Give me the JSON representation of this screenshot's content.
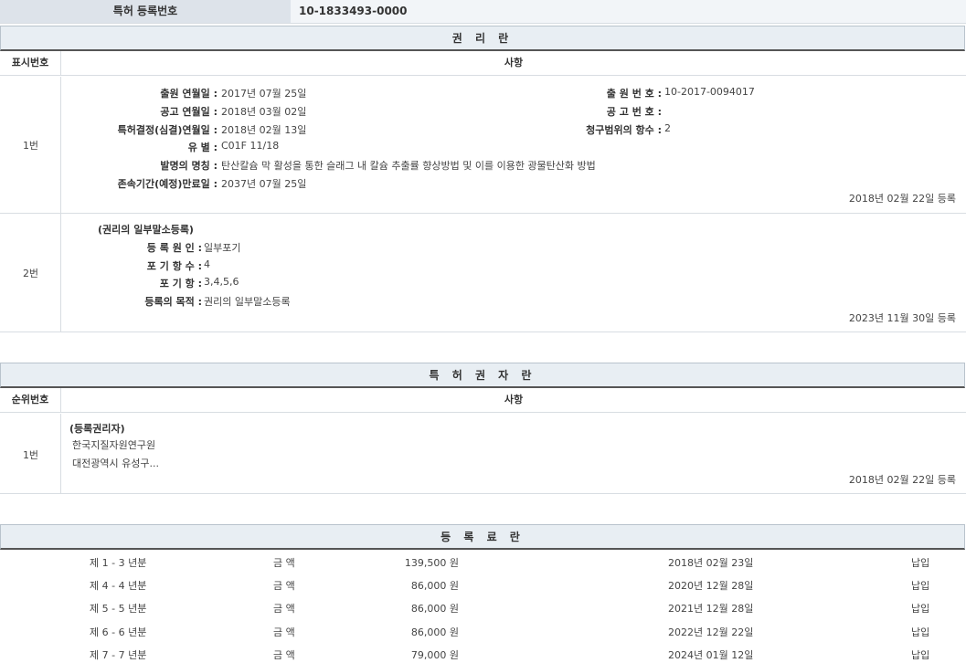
{
  "top": {
    "label": "특허 등록번호",
    "value": "10-1833493-0000"
  },
  "rights": {
    "title": "권 리 란",
    "col1": "표시번호",
    "col2": "사항",
    "row1": {
      "num": "1번",
      "filing_date_label": "출원 연월일 :",
      "filing_date": "2017년 07월 25일",
      "app_no_label": "출 원 번 호 :",
      "app_no": "10-2017-0094017",
      "pub_date_label": "공고 연월일 :",
      "pub_date": "2018년 03월 02일",
      "pub_no_label": "공 고 번 호 :",
      "pub_no": "",
      "decision_label": "특허결정(심결)연월일 :",
      "decision_date": "2018년 02월 13일",
      "claims_label": "청구범위의 항수 :",
      "claims": "2",
      "class_label": "유 별 :",
      "class": "C01F 11/18",
      "invention_label": "발명의 명칭 :",
      "invention": "탄산칼슘 막 활성을 통한 슬래그 내 칼슘 추출률 향상방법 및 이를 이용한 광물탄산화 방법",
      "expiry_label": "존속기간(예정)만료일 :",
      "expiry": "2037년 07월 25일",
      "reg": "2018년 02월 22일 등록"
    },
    "row2": {
      "num": "2번",
      "heading": "(권리의 일부말소등록)",
      "cause_label": "등 록 원 인 :",
      "cause": "일부포기",
      "count_label": "포 기 항 수 :",
      "count": "4",
      "items_label": "포 기 항 :",
      "items": "3,4,5,6",
      "purpose_label": "등록의 목적 :",
      "purpose": "권리의 일부말소등록",
      "reg": "2023년 11월 30일 등록"
    }
  },
  "holder": {
    "title": "특 허 권 자 란",
    "col1": "순위번호",
    "col2": "사항",
    "row1": {
      "num": "1번",
      "heading": "(등록권리자)",
      "name": "한국지질자원연구원",
      "address": "대전광역시 유성구...",
      "reg": "2018년 02월 22일 등록"
    }
  },
  "fees": {
    "title": "등 록 료 란",
    "rows": [
      {
        "period": "제 1 - 3 년분",
        "amount_label": "금 액",
        "amount": "139,500 원",
        "date": "2018년 02월 23일",
        "status": "납입"
      },
      {
        "period": "제 4 - 4 년분",
        "amount_label": "금 액",
        "amount": "86,000 원",
        "date": "2020년 12월 28일",
        "status": "납입"
      },
      {
        "period": "제 5 - 5 년분",
        "amount_label": "금 액",
        "amount": "86,000 원",
        "date": "2021년 12월 28일",
        "status": "납입"
      },
      {
        "period": "제 6 - 6 년분",
        "amount_label": "금 액",
        "amount": "86,000 원",
        "date": "2022년 12월 22일",
        "status": "납입"
      },
      {
        "period": "제 7 - 7 년분",
        "amount_label": "금 액",
        "amount": "79,000 원",
        "date": "2024년 01월 12일",
        "status": "납입"
      }
    ]
  }
}
